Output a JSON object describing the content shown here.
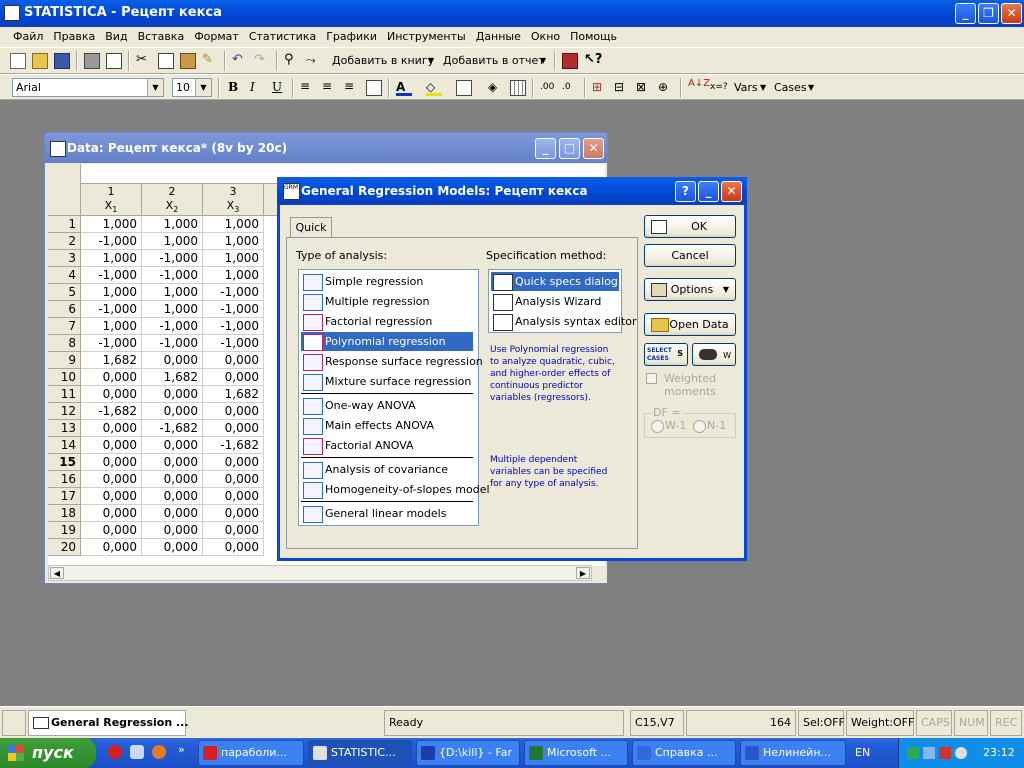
{
  "app": {
    "title": "STATISTICA - Рецепт кекса"
  },
  "menu": [
    "Файл",
    "Правка",
    "Вид",
    "Вставка",
    "Формат",
    "Статистика",
    "Графики",
    "Инструменты",
    "Данные",
    "Окно",
    "Помощь"
  ],
  "toolbar": {
    "add_workbook": "Добавить в книгу",
    "add_report": "Добавить в отчет",
    "font": "Arial",
    "size": "10",
    "vars": "Vars",
    "cases": "Cases"
  },
  "datawin": {
    "title": "Data: Рецепт кекса* (8v by 20c)",
    "columns": [
      {
        "num": "1",
        "name": "X",
        "sub": "1"
      },
      {
        "num": "2",
        "name": "X",
        "sub": "2"
      },
      {
        "num": "3",
        "name": "X",
        "sub": "3"
      }
    ],
    "rows": [
      {
        "n": "1",
        "v": [
          "1,000",
          "1,000",
          "1,000"
        ]
      },
      {
        "n": "2",
        "v": [
          "-1,000",
          "1,000",
          "1,000"
        ]
      },
      {
        "n": "3",
        "v": [
          "1,000",
          "-1,000",
          "1,000"
        ]
      },
      {
        "n": "4",
        "v": [
          "-1,000",
          "-1,000",
          "1,000"
        ]
      },
      {
        "n": "5",
        "v": [
          "1,000",
          "1,000",
          "-1,000"
        ]
      },
      {
        "n": "6",
        "v": [
          "-1,000",
          "1,000",
          "-1,000"
        ]
      },
      {
        "n": "7",
        "v": [
          "1,000",
          "-1,000",
          "-1,000"
        ]
      },
      {
        "n": "8",
        "v": [
          "-1,000",
          "-1,000",
          "-1,000"
        ]
      },
      {
        "n": "9",
        "v": [
          "1,682",
          "0,000",
          "0,000"
        ]
      },
      {
        "n": "10",
        "v": [
          "0,000",
          "1,682",
          "0,000"
        ]
      },
      {
        "n": "11",
        "v": [
          "0,000",
          "0,000",
          "1,682"
        ]
      },
      {
        "n": "12",
        "v": [
          "-1,682",
          "0,000",
          "0,000"
        ]
      },
      {
        "n": "13",
        "v": [
          "0,000",
          "-1,682",
          "0,000"
        ]
      },
      {
        "n": "14",
        "v": [
          "0,000",
          "0,000",
          "-1,682"
        ]
      },
      {
        "n": "15",
        "v": [
          "0,000",
          "0,000",
          "0,000"
        ]
      },
      {
        "n": "16",
        "v": [
          "0,000",
          "0,000",
          "0,000"
        ]
      },
      {
        "n": "17",
        "v": [
          "0,000",
          "0,000",
          "0,000"
        ]
      },
      {
        "n": "18",
        "v": [
          "0,000",
          "0,000",
          "0,000"
        ]
      },
      {
        "n": "19",
        "v": [
          "0,000",
          "0,000",
          "0,000"
        ]
      },
      {
        "n": "20",
        "v": [
          "0,000",
          "0,000",
          "0,000"
        ]
      }
    ]
  },
  "dialog": {
    "title": "General Regression Models: Рецепт кекса",
    "tab": "Quick",
    "type_label": "Type of analysis:",
    "types": [
      {
        "label": "Simple regression",
        "sel": false
      },
      {
        "label": "Multiple regression",
        "sel": false
      },
      {
        "label": "Factorial regression",
        "sel": false
      },
      {
        "label": "Polynomial regression",
        "sel": true
      },
      {
        "label": "Response surface regression",
        "sel": false
      },
      {
        "label": "Mixture surface regression",
        "sel": false
      },
      {
        "label": "One-way ANOVA",
        "sel": false
      },
      {
        "label": "Main effects ANOVA",
        "sel": false
      },
      {
        "label": "Factorial ANOVA",
        "sel": false
      },
      {
        "label": "Analysis of covariance",
        "sel": false
      },
      {
        "label": "Homogeneity-of-slopes model",
        "sel": false
      },
      {
        "label": "General linear models",
        "sel": false
      }
    ],
    "spec_label": "Specification method:",
    "specs": [
      {
        "label": "Quick specs dialog",
        "sel": true
      },
      {
        "label": "Analysis Wizard",
        "sel": false
      },
      {
        "label": "Analysis syntax editor",
        "sel": false
      }
    ],
    "info1": [
      "Use Polynomial regression",
      "to analyze quadratic, cubic,",
      "and higher-order effects of",
      "continuous predictor",
      "variables (regressors)."
    ],
    "info2": [
      "Multiple dependent",
      "variables can be specified",
      "for any type of analysis."
    ],
    "ok": "OK",
    "cancel": "Cancel",
    "options": "Options",
    "open_data": "Open Data",
    "select_cases": [
      "SELECT",
      "CASES"
    ],
    "s_label": "S",
    "w_label": "W",
    "weighted": "Weighted moments",
    "df_label": "DF =",
    "w1": "W-1",
    "n1": "N-1"
  },
  "status": {
    "task": "General Regression ...",
    "ready": "Ready",
    "cell": "C15,V7",
    "num": "164",
    "sel": "Sel:OFF",
    "weight": "Weight:OFF",
    "caps": "CAPS",
    "numlk": "NUM",
    "rec": "REC"
  },
  "taskbar": {
    "start": "пуск",
    "tasks": [
      {
        "label": "параболи...",
        "color": "#d42020"
      },
      {
        "label": "STATISTIC...",
        "color": "#e0e0e0"
      },
      {
        "label": "{D:\\kill} - Far",
        "color": "#1d3ea6"
      },
      {
        "label": "Microsoft ...",
        "color": "#1f7a36"
      },
      {
        "label": "Справка ...",
        "color": "#2e6bd9"
      },
      {
        "label": "Нелинейн...",
        "color": "#2b58c4"
      }
    ],
    "lang": "EN",
    "clock": "23:12"
  }
}
